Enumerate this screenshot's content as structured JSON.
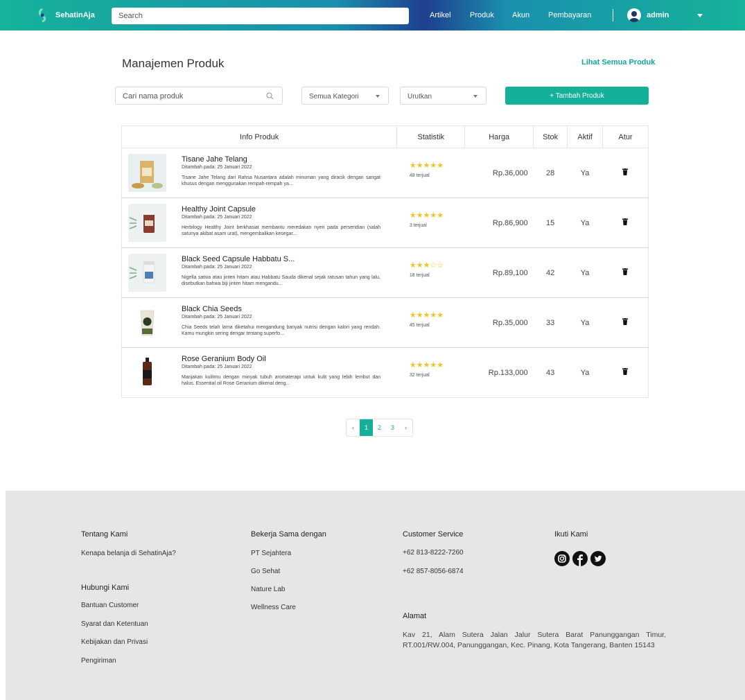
{
  "navbar": {
    "brand": "SehatinAja",
    "search_placeholder": "Search",
    "links": [
      "Artikel",
      "Produk",
      "Akun",
      "Pembayaran"
    ],
    "user": "admin"
  },
  "main": {
    "title": "Manajemen Produk",
    "see_all": "Lihat Semua Produk",
    "search_placeholder": "Cari nama produk",
    "category_select": "Semua Kategori",
    "sort_select": "Urutkan",
    "add_button": "+ Tambah Produk"
  },
  "table": {
    "headers": [
      "Info Produk",
      "Statistik",
      "Harga",
      "Stok",
      "Aktif",
      "Atur"
    ],
    "rows": [
      {
        "name": "Tisane Jahe Telang",
        "added": "Ditambah pada: 25 Januari 2022",
        "desc": "Tisane Jahe Telang dari Rahsa Nusantara adalah minuman yang diracik dengan sangat khusus dengan menggunakan rempah-rempah ya...",
        "stars": "★★★★★",
        "sold": "48 terjual",
        "price": "Rp.36,000",
        "stock": "28",
        "active": "Ya"
      },
      {
        "name": "Healthy Joint Capsule",
        "added": "Ditambah pada: 25 Januari 2022",
        "desc": "Herbilogy Healthy Joint berkhasiat membantu meredakan nyeri pada persendian (salah satunya akibat asam urat), mengembalikan kesegar...",
        "stars": "★★★★★",
        "sold": "3 terjual",
        "price": "Rp.86,900",
        "stock": "15",
        "active": "Ya"
      },
      {
        "name": "Black Seed Capsule Habbatu S...",
        "added": "Ditambah pada: 25 Januari 2022",
        "desc": "Nigella sativa atau jinten hitam atau Habbatu Sauda dikenal sejak ratusan tahun yang lalu, disebutkan bahwa biji jinten hitam mengandu...",
        "stars": "★★★☆☆",
        "sold": "18 terjual",
        "price": "Rp.89,100",
        "stock": "42",
        "active": "Ya"
      },
      {
        "name": "Black Chia Seeds",
        "added": "Ditambah pada: 25 Januari 2022",
        "desc": "Chia Seeds telah lama diketahui mengandung banyak nutrisi dengan kalori yang rendah. Kamu mungkin sering dengar tentang superfo...",
        "stars": "★★★★★",
        "sold": "45 terjual",
        "price": "Rp.35,000",
        "stock": "33",
        "active": "Ya"
      },
      {
        "name": "Rose Geranium Body Oil",
        "added": "Ditambah pada: 25 Januari 2022",
        "desc": "Manjakan kulitmu dengan minyak tubuh aromaterapi untuk kulit yang lebih lembut dan halus. Essential oil Rose Geranium dikenal deng...",
        "stars": "★★★★★",
        "sold": "32 terjual",
        "price": "Rp.133,000",
        "stock": "43",
        "active": "Ya"
      }
    ]
  },
  "pagination": {
    "prev": "‹",
    "pages": [
      "1",
      "2",
      "3"
    ],
    "next": "›",
    "current": "1"
  },
  "footer": {
    "about_title": "Tentang Kami",
    "about_links": [
      "Kenapa belanja di SehatinAja?"
    ],
    "contact_title": "Hubungi Kami",
    "contact_links": [
      "Bantuan Customer",
      "Syarat dan Ketentuan",
      "Kebijakan dan Privasi",
      "Pengiriman"
    ],
    "partners_title": "Bekerja Sama dengan",
    "partners": [
      "PT Sejahtera",
      "Go Sehat",
      "Nature Lab",
      "Wellness Care"
    ],
    "cs_title": "Customer Service",
    "phones": [
      "+62 813-8222-7260",
      "+62 857-8056-6874"
    ],
    "address_title": "Alamat",
    "address": "Kav 21, Alam Sutera Jalan Jalur Sutera Barat Panunggangan Timur, RT.001/RW.004, Panunggangan, Kec. Pinang, Kota Tangerang, Banten 15143",
    "follow_title": "Ikuti Kami",
    "social_icons": [
      "instagram-icon",
      "facebook-icon",
      "twitter-icon"
    ]
  },
  "colors": {
    "accent": "#14b09a",
    "nav_dark": "#1f3f8f",
    "footer_bg": "#e6e6e6",
    "star": "#f0c419"
  }
}
